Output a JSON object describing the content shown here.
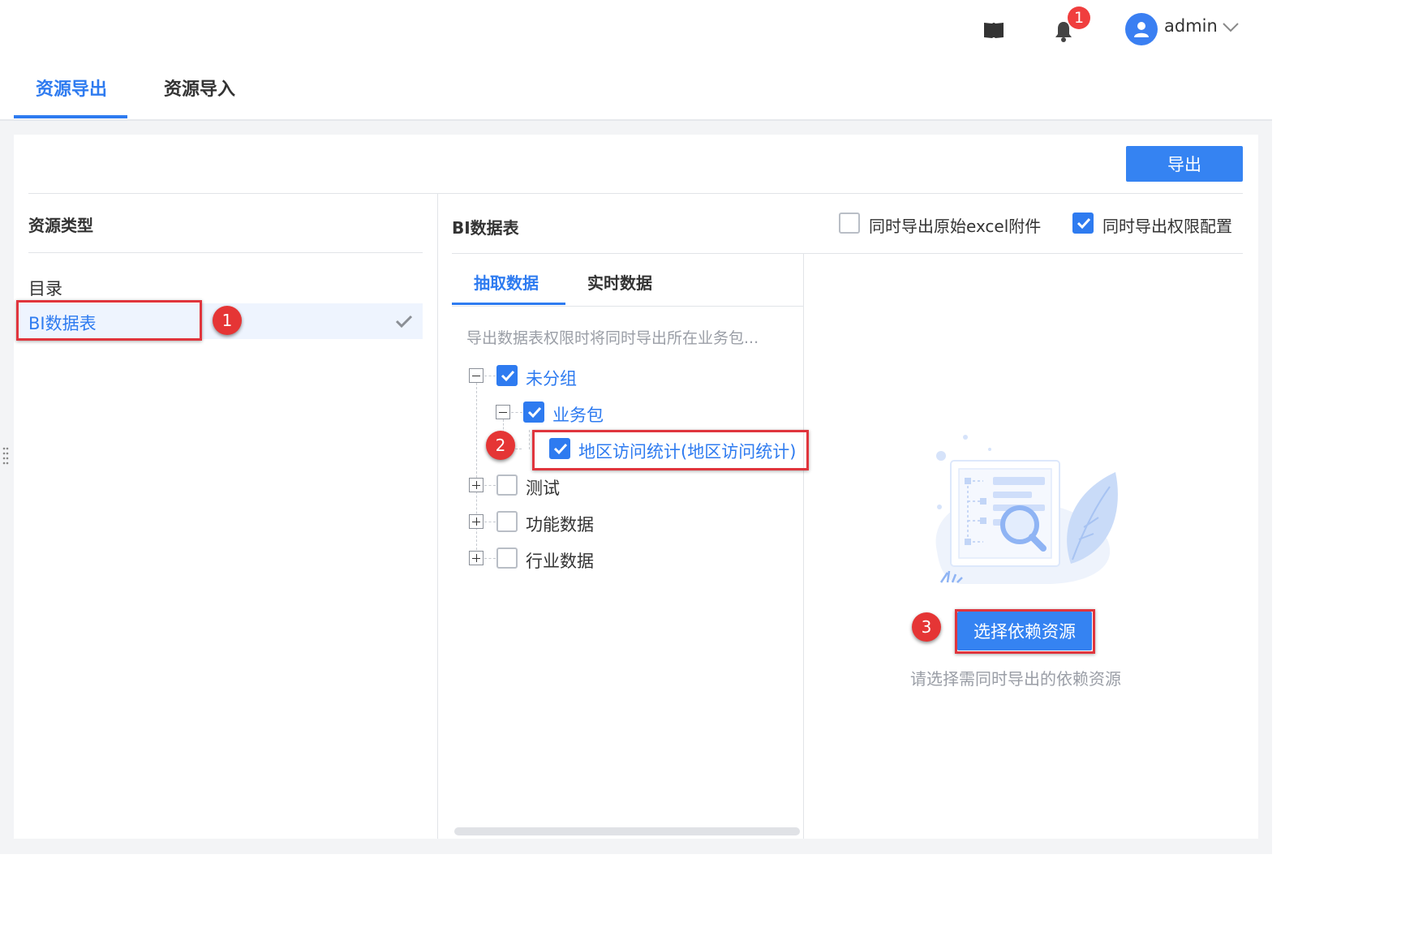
{
  "header": {
    "help_icon": "book-icon",
    "notification_icon": "bell-icon",
    "notification_count": "1",
    "user": {
      "name": "admin",
      "avatar_icon": "user-icon",
      "dropdown_icon": "chevron-down-icon"
    }
  },
  "main_tabs": [
    {
      "label": "资源导出",
      "active": true
    },
    {
      "label": "资源导入",
      "active": false
    }
  ],
  "toolbar": {
    "export_label": "导出"
  },
  "resource_type": {
    "title": "资源类型",
    "items": [
      {
        "label": "目录",
        "selected": false
      },
      {
        "label": "BI数据表",
        "selected": true,
        "check_icon": "check-icon"
      }
    ]
  },
  "bi_table": {
    "title": "BI数据表",
    "options": [
      {
        "label": "同时导出原始excel附件",
        "checked": false
      },
      {
        "label": "同时导出权限配置",
        "checked": true
      }
    ],
    "subtabs": [
      {
        "label": "抽取数据",
        "active": true
      },
      {
        "label": "实时数据",
        "active": false
      }
    ],
    "hint": "导出数据表权限时将同时导出所在业务包...",
    "tree": [
      {
        "label": "未分组",
        "checked": true,
        "expanded": true
      },
      {
        "label": "业务包",
        "checked": true,
        "expanded": true
      },
      {
        "label": "地区访问统计(地区访问统计)",
        "checked": true
      },
      {
        "label": "测试",
        "checked": false,
        "expanded": false
      },
      {
        "label": "功能数据",
        "checked": false,
        "expanded": false
      },
      {
        "label": "行业数据",
        "checked": false,
        "expanded": false
      }
    ]
  },
  "dependency": {
    "button_label": "选择依赖资源",
    "empty_text": "请选择需同时导出的依赖资源",
    "illustration_icon": "empty-search-illustration"
  },
  "annotations": [
    "1",
    "2",
    "3"
  ],
  "colors": {
    "accent": "#2e7bf0",
    "button": "#3583f2",
    "annotation": "#e53535",
    "badge": "#f03e3e"
  }
}
